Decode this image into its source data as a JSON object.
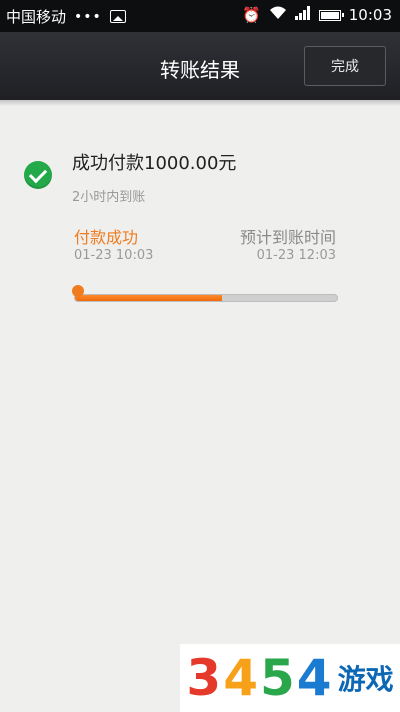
{
  "status_bar": {
    "carrier": "中国移动",
    "dots": "•••",
    "time": "10:03"
  },
  "nav": {
    "title": "转账结果",
    "done_label": "完成"
  },
  "result": {
    "main_text": "成功付款1000.00元",
    "sub_text": "2小时内到账"
  },
  "steps": {
    "left_label": "付款成功",
    "left_time": "01-23 10:03",
    "right_label": "预计到账时间",
    "right_time": "01-23 12:03",
    "progress_percent": 56
  },
  "watermark": {
    "digits": [
      "3",
      "4",
      "5",
      "4"
    ],
    "text": "游戏",
    "digit_colors": [
      "#e53a2b",
      "#f7a01a",
      "#2aa74a",
      "#1a7bd0"
    ]
  },
  "colors": {
    "accent_orange": "#f07c1f",
    "success_green": "#23a84a"
  }
}
